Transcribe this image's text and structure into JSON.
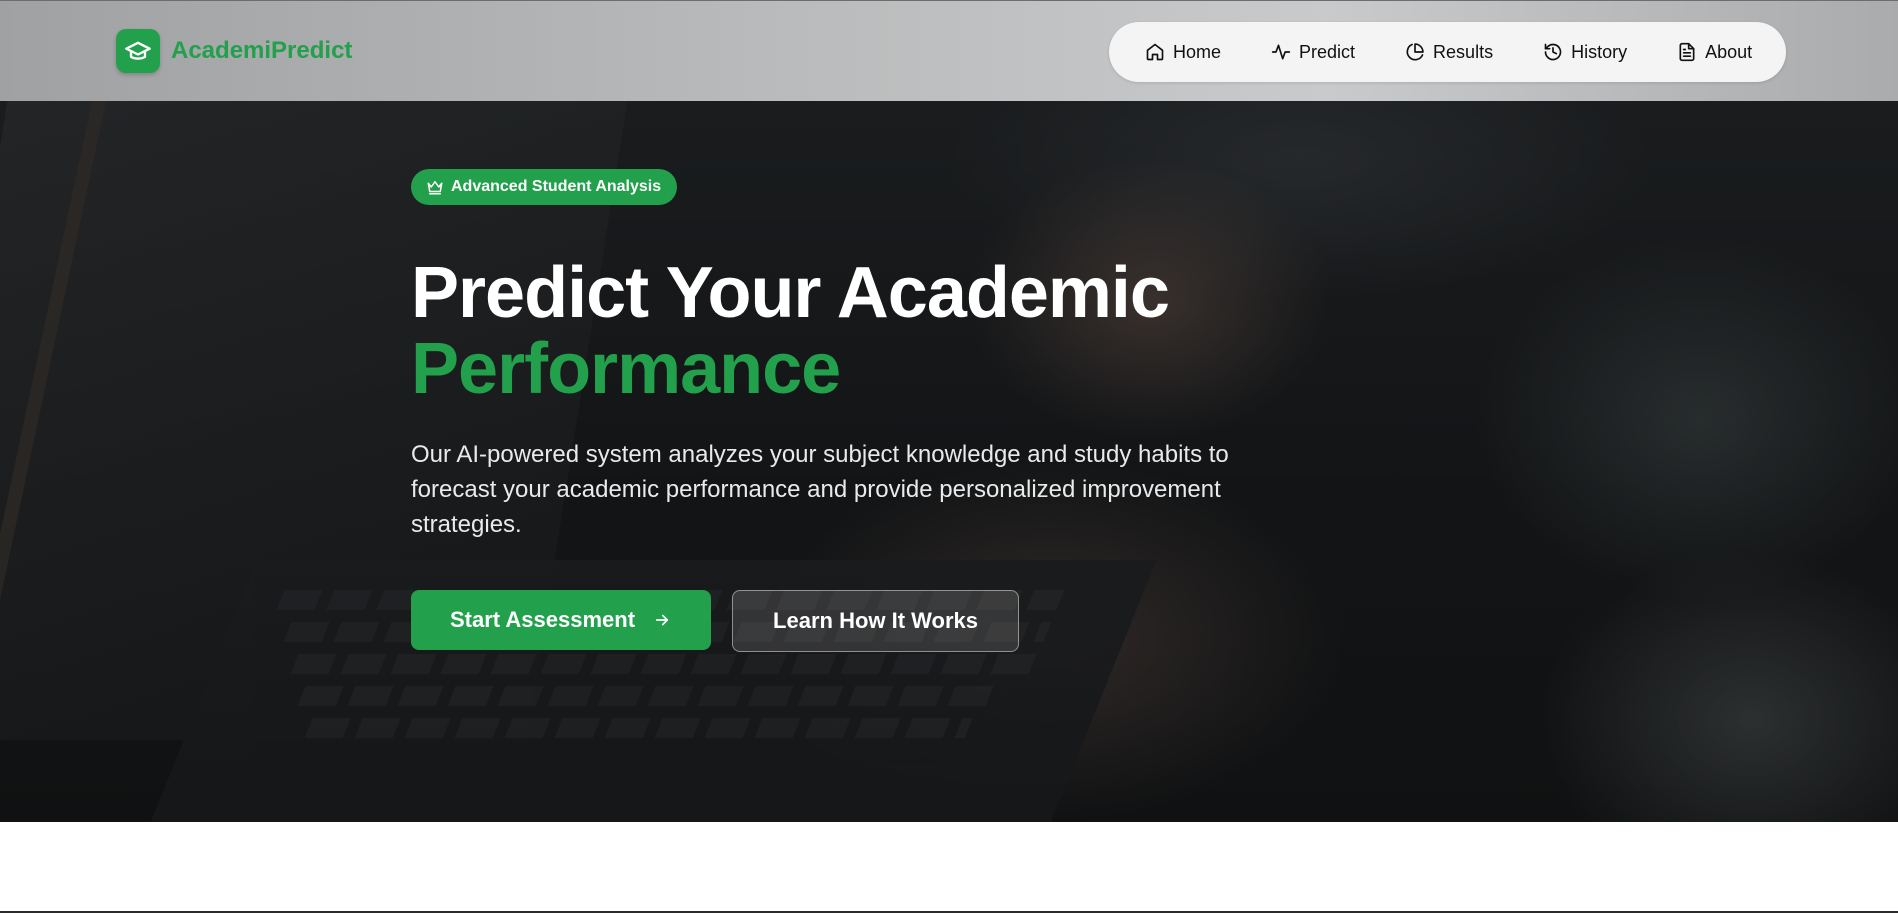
{
  "brand": {
    "name": "AcademiPredict",
    "logo_icon": "graduation-cap-icon",
    "color": "#22a04c"
  },
  "nav": {
    "items": [
      {
        "label": "Home",
        "icon": "home-icon"
      },
      {
        "label": "Predict",
        "icon": "activity-icon"
      },
      {
        "label": "Results",
        "icon": "pie-chart-icon"
      },
      {
        "label": "History",
        "icon": "history-icon"
      },
      {
        "label": "About",
        "icon": "document-icon"
      }
    ]
  },
  "hero": {
    "badge": {
      "label": "Advanced Student Analysis",
      "icon": "crown-icon"
    },
    "title_line1": "Predict Your Academic",
    "title_line2": "Performance",
    "description": "Our AI-powered system analyzes your subject knowledge and study habits to forecast your academic performance and provide personalized improvement strategies.",
    "primary_cta": {
      "label": "Start Assessment",
      "icon": "arrow-right-icon"
    },
    "secondary_cta": {
      "label": "Learn How It Works"
    }
  },
  "colors": {
    "accent": "#22a04c",
    "text_light": "#ffffff"
  }
}
